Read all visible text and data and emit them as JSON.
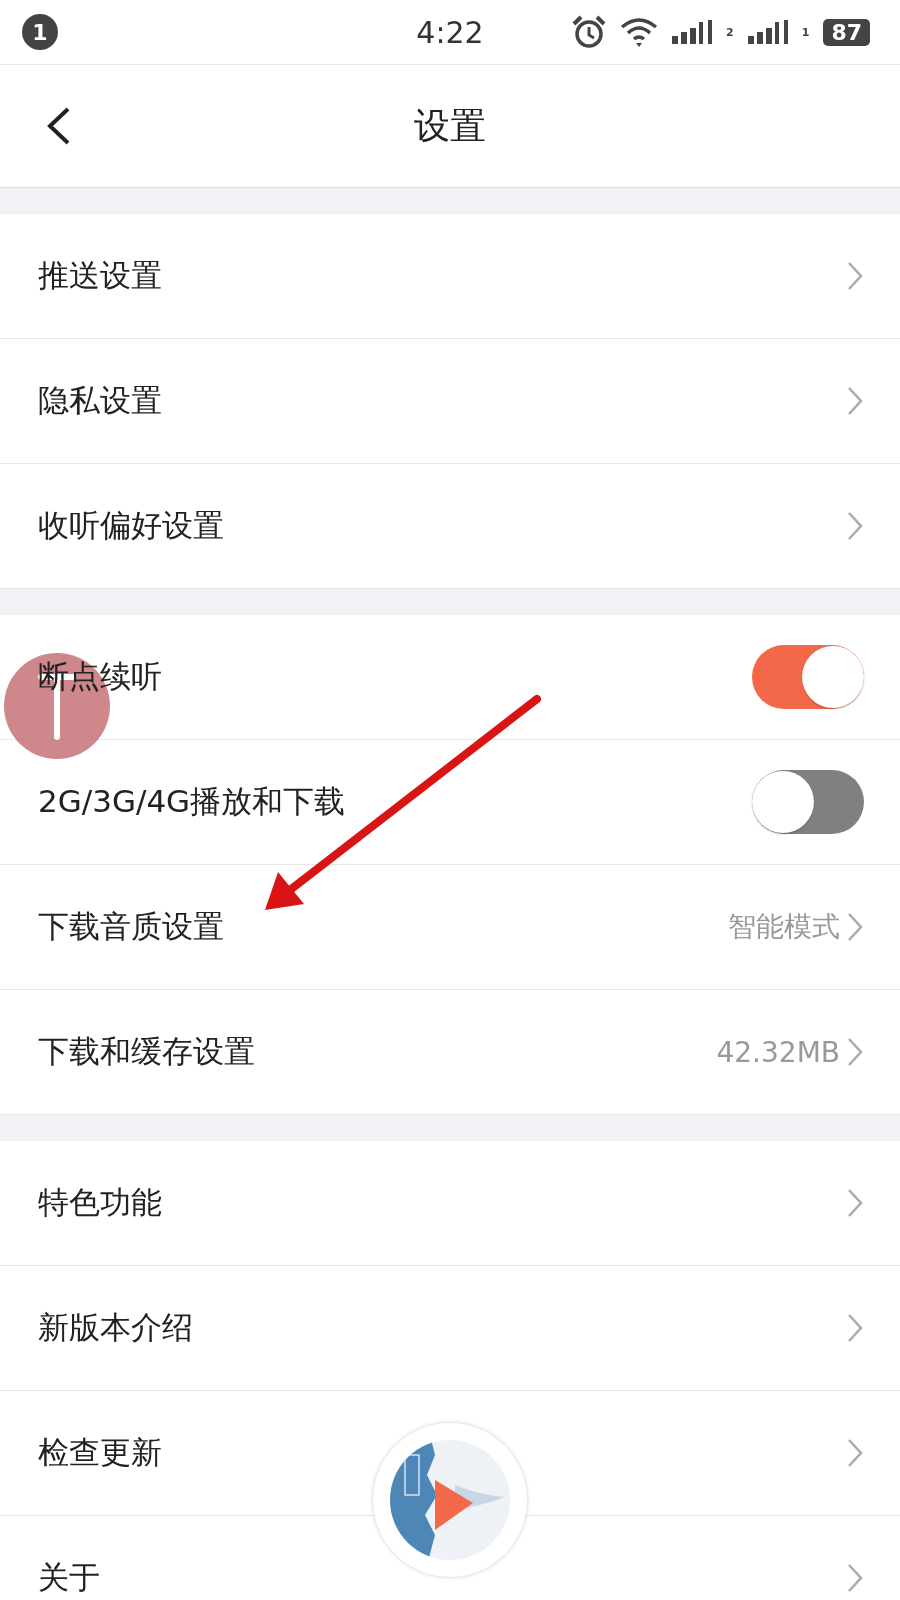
{
  "status_bar": {
    "notification_count": "1",
    "time": "4:22",
    "sim_slots": [
      "2",
      "1"
    ],
    "battery": "87"
  },
  "header": {
    "title": "设置"
  },
  "groups": [
    {
      "rows": [
        {
          "kind": "link",
          "label": "推送设置"
        },
        {
          "kind": "link",
          "label": "隐私设置"
        },
        {
          "kind": "link",
          "label": "收听偏好设置"
        }
      ]
    },
    {
      "rows": [
        {
          "kind": "toggle",
          "label": "断点续听",
          "on": true
        },
        {
          "kind": "toggle",
          "label": "2G/3G/4G播放和下载",
          "on": false
        },
        {
          "kind": "link",
          "label": "下载音质设置",
          "value": "智能模式"
        },
        {
          "kind": "link",
          "label": "下载和缓存设置",
          "value": "42.32MB"
        }
      ]
    },
    {
      "rows": [
        {
          "kind": "link",
          "label": "特色功能"
        },
        {
          "kind": "link",
          "label": "新版本介绍"
        },
        {
          "kind": "link",
          "label": "检查更新"
        },
        {
          "kind": "link",
          "label": "关于"
        }
      ]
    }
  ]
}
